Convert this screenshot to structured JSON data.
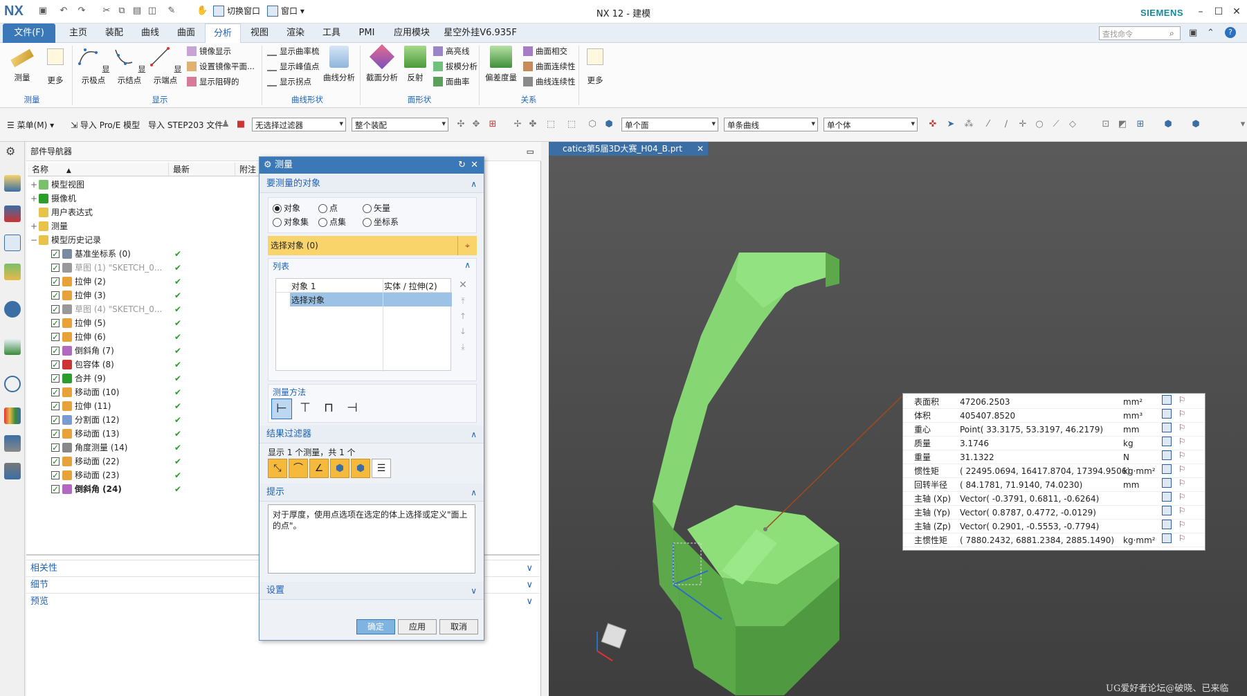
{
  "titlebar": {
    "logo": "NX",
    "switch_window": "切换窗口",
    "window": "窗口",
    "title": "NX 12 - 建模",
    "brand": "SIEMENS"
  },
  "menu": {
    "items": [
      "文件(F)",
      "主页",
      "装配",
      "曲线",
      "曲面",
      "分析",
      "视图",
      "渲染",
      "工具",
      "PMI",
      "应用模块",
      "星空外挂V6.935F"
    ],
    "active": "分析",
    "search_placeholder": "查找命令"
  },
  "ribbon": {
    "measure": "测量",
    "more1": "更多",
    "show_poles": "显示极点",
    "show_knots": "显示结点",
    "show_endpoints": "显示端点",
    "mirror_display": "镜像显示",
    "set_mirror_plane": "设置镜像平面...",
    "show_blocked": "显示阻碍的",
    "show_curvature_comb": "显示曲率梳",
    "show_peak": "显示峰值点",
    "show_inflection": "显示拐点",
    "curve_analysis": "曲线分析",
    "section_analysis": "截面分析",
    "reflection": "反射",
    "highlight_lines": "高亮线",
    "draft_analysis": "拔模分析",
    "face_curvature": "面曲率",
    "deviation_gauge": "偏差度量",
    "face_intersection": "曲面相交",
    "face_continuity": "曲面连续性",
    "curve_continuity": "曲线连续性",
    "more2": "更多",
    "groups": [
      "测量",
      "显示",
      "曲线形状",
      "面形状",
      "关系"
    ]
  },
  "toolbar2": {
    "menu": "菜单(M)",
    "import_proe": "导入 Pro/E 模型",
    "import_step": "导入 STEP203 文件",
    "filter": "无选择过滤器",
    "assembly": "整个装配",
    "face_rule": "单个面",
    "curve_rule": "单条曲线",
    "body_rule": "单个体"
  },
  "navigator": {
    "title": "部件导航器",
    "col_name": "名称",
    "col_latest": "最新",
    "col_attach": "附注",
    "top_nodes": [
      "模型视图",
      "摄像机",
      "用户表达式",
      "测量",
      "模型历史记录"
    ],
    "features": [
      {
        "label": "基准坐标系 (0)",
        "grey": false,
        "bold": false,
        "icon": "csys"
      },
      {
        "label": "草图 (1) \"SKETCH_0...",
        "grey": true,
        "bold": false,
        "icon": "sketch"
      },
      {
        "label": "拉伸 (2)",
        "grey": false,
        "bold": false,
        "icon": "extrude"
      },
      {
        "label": "拉伸 (3)",
        "grey": false,
        "bold": false,
        "icon": "extrude"
      },
      {
        "label": "草图 (4) \"SKETCH_0...",
        "grey": true,
        "bold": false,
        "icon": "sketch"
      },
      {
        "label": "拉伸 (5)",
        "grey": false,
        "bold": false,
        "icon": "extrude"
      },
      {
        "label": "拉伸 (6)",
        "grey": false,
        "bold": false,
        "icon": "extrude"
      },
      {
        "label": "倒斜角 (7)",
        "grey": false,
        "bold": false,
        "icon": "chamfer"
      },
      {
        "label": "包容体 (8)",
        "grey": false,
        "bold": false,
        "icon": "box"
      },
      {
        "label": "合并 (9)",
        "grey": false,
        "bold": false,
        "icon": "unite"
      },
      {
        "label": "移动面 (10)",
        "grey": false,
        "bold": false,
        "icon": "move"
      },
      {
        "label": "拉伸 (11)",
        "grey": false,
        "bold": false,
        "icon": "extrude"
      },
      {
        "label": "分割面 (12)",
        "grey": false,
        "bold": false,
        "icon": "split"
      },
      {
        "label": "移动面 (13)",
        "grey": false,
        "bold": false,
        "icon": "move"
      },
      {
        "label": "角度测量 (14)",
        "grey": false,
        "bold": false,
        "icon": "angle"
      },
      {
        "label": "移动面 (22)",
        "grey": false,
        "bold": false,
        "icon": "move"
      },
      {
        "label": "移动面 (23)",
        "grey": false,
        "bold": false,
        "icon": "move"
      },
      {
        "label": "倒斜角 (24)",
        "grey": false,
        "bold": true,
        "icon": "chamfer"
      }
    ],
    "bottom_panels": [
      "相关性",
      "细节",
      "预览"
    ]
  },
  "dialog": {
    "title": "测量",
    "sect_objects": "要测量的对象",
    "radios": [
      {
        "label": "对象",
        "on": true
      },
      {
        "label": "点",
        "on": false
      },
      {
        "label": "矢量",
        "on": false
      },
      {
        "label": "对象集",
        "on": false
      },
      {
        "label": "点集",
        "on": false
      },
      {
        "label": "坐标系",
        "on": false
      }
    ],
    "select_object": "选择对象 (0)",
    "list_header": "列表",
    "list_col1": "对象 1",
    "list_col2": "实体 / 拉伸(2)",
    "list_row2": "选择对象",
    "method_label": "测量方法",
    "sect_filter": "结果过滤器",
    "filter_info": "显示 1 个测量，共 1 个",
    "sect_tips": "提示",
    "tip_text": "对于厚度，使用点选项在选定的体上选择或定义\"面上的点\"。",
    "sect_settings": "设置",
    "ok": "确定",
    "apply": "应用",
    "cancel": "取消"
  },
  "viewport": {
    "tab": "catics第5届3D大赛_H04_B.prt",
    "model_color": "#8ee07c",
    "watermark": "UG爱好者论坛@破晓、已来临"
  },
  "results": [
    {
      "label": "表面积",
      "value": "47206.2503",
      "unit": "mm²"
    },
    {
      "label": "体积",
      "value": "405407.8520",
      "unit": "mm³"
    },
    {
      "label": "重心",
      "value": "Point( 33.3175, 53.3197, 46.2179)",
      "unit": "mm"
    },
    {
      "label": "质量",
      "value": "3.1746",
      "unit": "kg"
    },
    {
      "label": "重量",
      "value": "31.1322",
      "unit": "N"
    },
    {
      "label": "惯性矩",
      "value": "( 22495.0694, 16417.8704, 17394.9506)",
      "unit": "kg·mm²"
    },
    {
      "label": "回转半径",
      "value": "( 84.1781, 71.9140, 74.0230)",
      "unit": "mm"
    },
    {
      "label": "主轴 (Xp)",
      "value": "Vector( -0.3791, 0.6811, -0.6264)",
      "unit": ""
    },
    {
      "label": "主轴 (Yp)",
      "value": "Vector( 0.8787, 0.4772, -0.0129)",
      "unit": ""
    },
    {
      "label": "主轴 (Zp)",
      "value": "Vector( 0.2901, -0.5553, -0.7794)",
      "unit": ""
    },
    {
      "label": "主惯性矩",
      "value": "( 7880.2432, 6881.2384, 2885.1490)",
      "unit": "kg·mm²"
    }
  ]
}
